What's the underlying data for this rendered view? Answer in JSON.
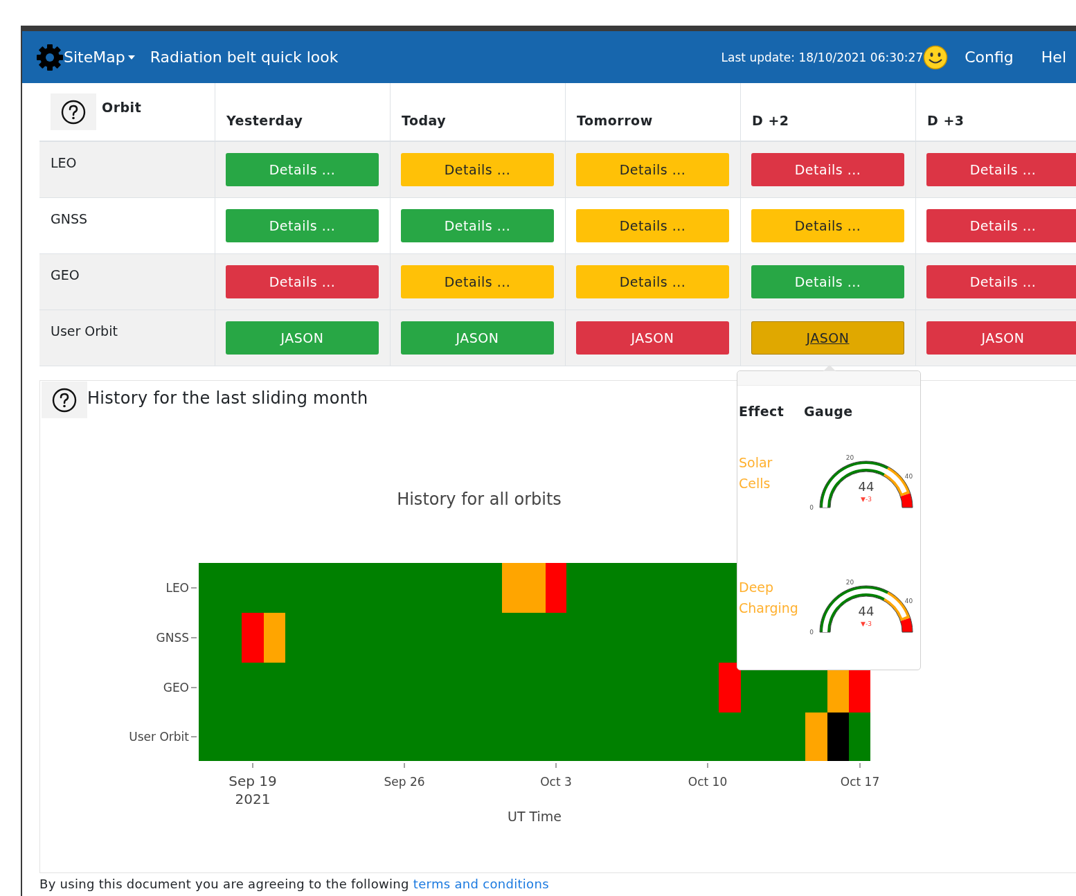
{
  "navbar": {
    "brand": "SiteMap",
    "title": "Radiation belt quick look",
    "last_update": "Last update: 18/10/2021 06:30:27",
    "links": [
      "Config",
      "Hel"
    ]
  },
  "table": {
    "orbit_header": "Orbit",
    "columns": [
      "Yesterday",
      "Today",
      "Tomorrow",
      "D +2",
      "D +3"
    ],
    "rows": [
      {
        "label": "LEO",
        "highlighted": true,
        "cells": [
          {
            "label": "Details ...",
            "color": "#28a745",
            "selected": false
          },
          {
            "label": "Details ...",
            "color": "#ffc107",
            "selected": false
          },
          {
            "label": "Details ...",
            "color": "#ffc107",
            "selected": false
          },
          {
            "label": "Details ...",
            "color": "#dc3545",
            "selected": false
          },
          {
            "label": "Details ...",
            "color": "#dc3545",
            "selected": false
          }
        ]
      },
      {
        "label": "GNSS",
        "highlighted": false,
        "cells": [
          {
            "label": "Details ...",
            "color": "#28a745",
            "selected": false
          },
          {
            "label": "Details ...",
            "color": "#28a745",
            "selected": false
          },
          {
            "label": "Details ...",
            "color": "#ffc107",
            "selected": false
          },
          {
            "label": "Details ...",
            "color": "#ffc107",
            "selected": false
          },
          {
            "label": "Details ...",
            "color": "#dc3545",
            "selected": false
          }
        ]
      },
      {
        "label": "GEO",
        "highlighted": true,
        "cells": [
          {
            "label": "Details ...",
            "color": "#dc3545",
            "selected": false
          },
          {
            "label": "Details ...",
            "color": "#ffc107",
            "selected": false
          },
          {
            "label": "Details ...",
            "color": "#ffc107",
            "selected": false
          },
          {
            "label": "Details ...",
            "color": "#28a745",
            "selected": false
          },
          {
            "label": "Details ...",
            "color": "#dc3545",
            "selected": false
          }
        ]
      },
      {
        "label": "User Orbit",
        "highlighted": true,
        "cells": [
          {
            "label": "JASON",
            "color": "#28a745",
            "selected": false
          },
          {
            "label": "JASON",
            "color": "#28a745",
            "selected": false
          },
          {
            "label": "JASON",
            "color": "#dc3545",
            "selected": false
          },
          {
            "label": "JASON",
            "color": "#e0a800",
            "selected": true
          },
          {
            "label": "JASON",
            "color": "#dc3545",
            "selected": false
          }
        ]
      }
    ]
  },
  "popover": {
    "columns": [
      "Effect",
      "Gauge"
    ],
    "rows": [
      {
        "effect": "Solar Cells",
        "value": "44",
        "delta": "▼-3",
        "ticks": [
          "0",
          "20",
          "40"
        ]
      },
      {
        "effect": "Deep Charging",
        "value": "44",
        "delta": "▼-3",
        "ticks": [
          "0",
          "20",
          "40"
        ]
      }
    ]
  },
  "history": {
    "title": "History for the last sliding month",
    "chart_title": "History for all orbits",
    "y_labels": [
      "LEO",
      "GNSS",
      "GEO",
      "User Orbit"
    ],
    "x_ticks": [
      {
        "label": "Sep 19",
        "sublabel": "2021"
      },
      {
        "label": "Sep 26"
      },
      {
        "label": "Oct 3"
      },
      {
        "label": "Oct 10"
      },
      {
        "label": "Oct 17"
      }
    ],
    "x_title": "UT Time"
  },
  "footer": {
    "text": "By using this document you are agreeing to the following",
    "link": "terms and conditions"
  }
}
